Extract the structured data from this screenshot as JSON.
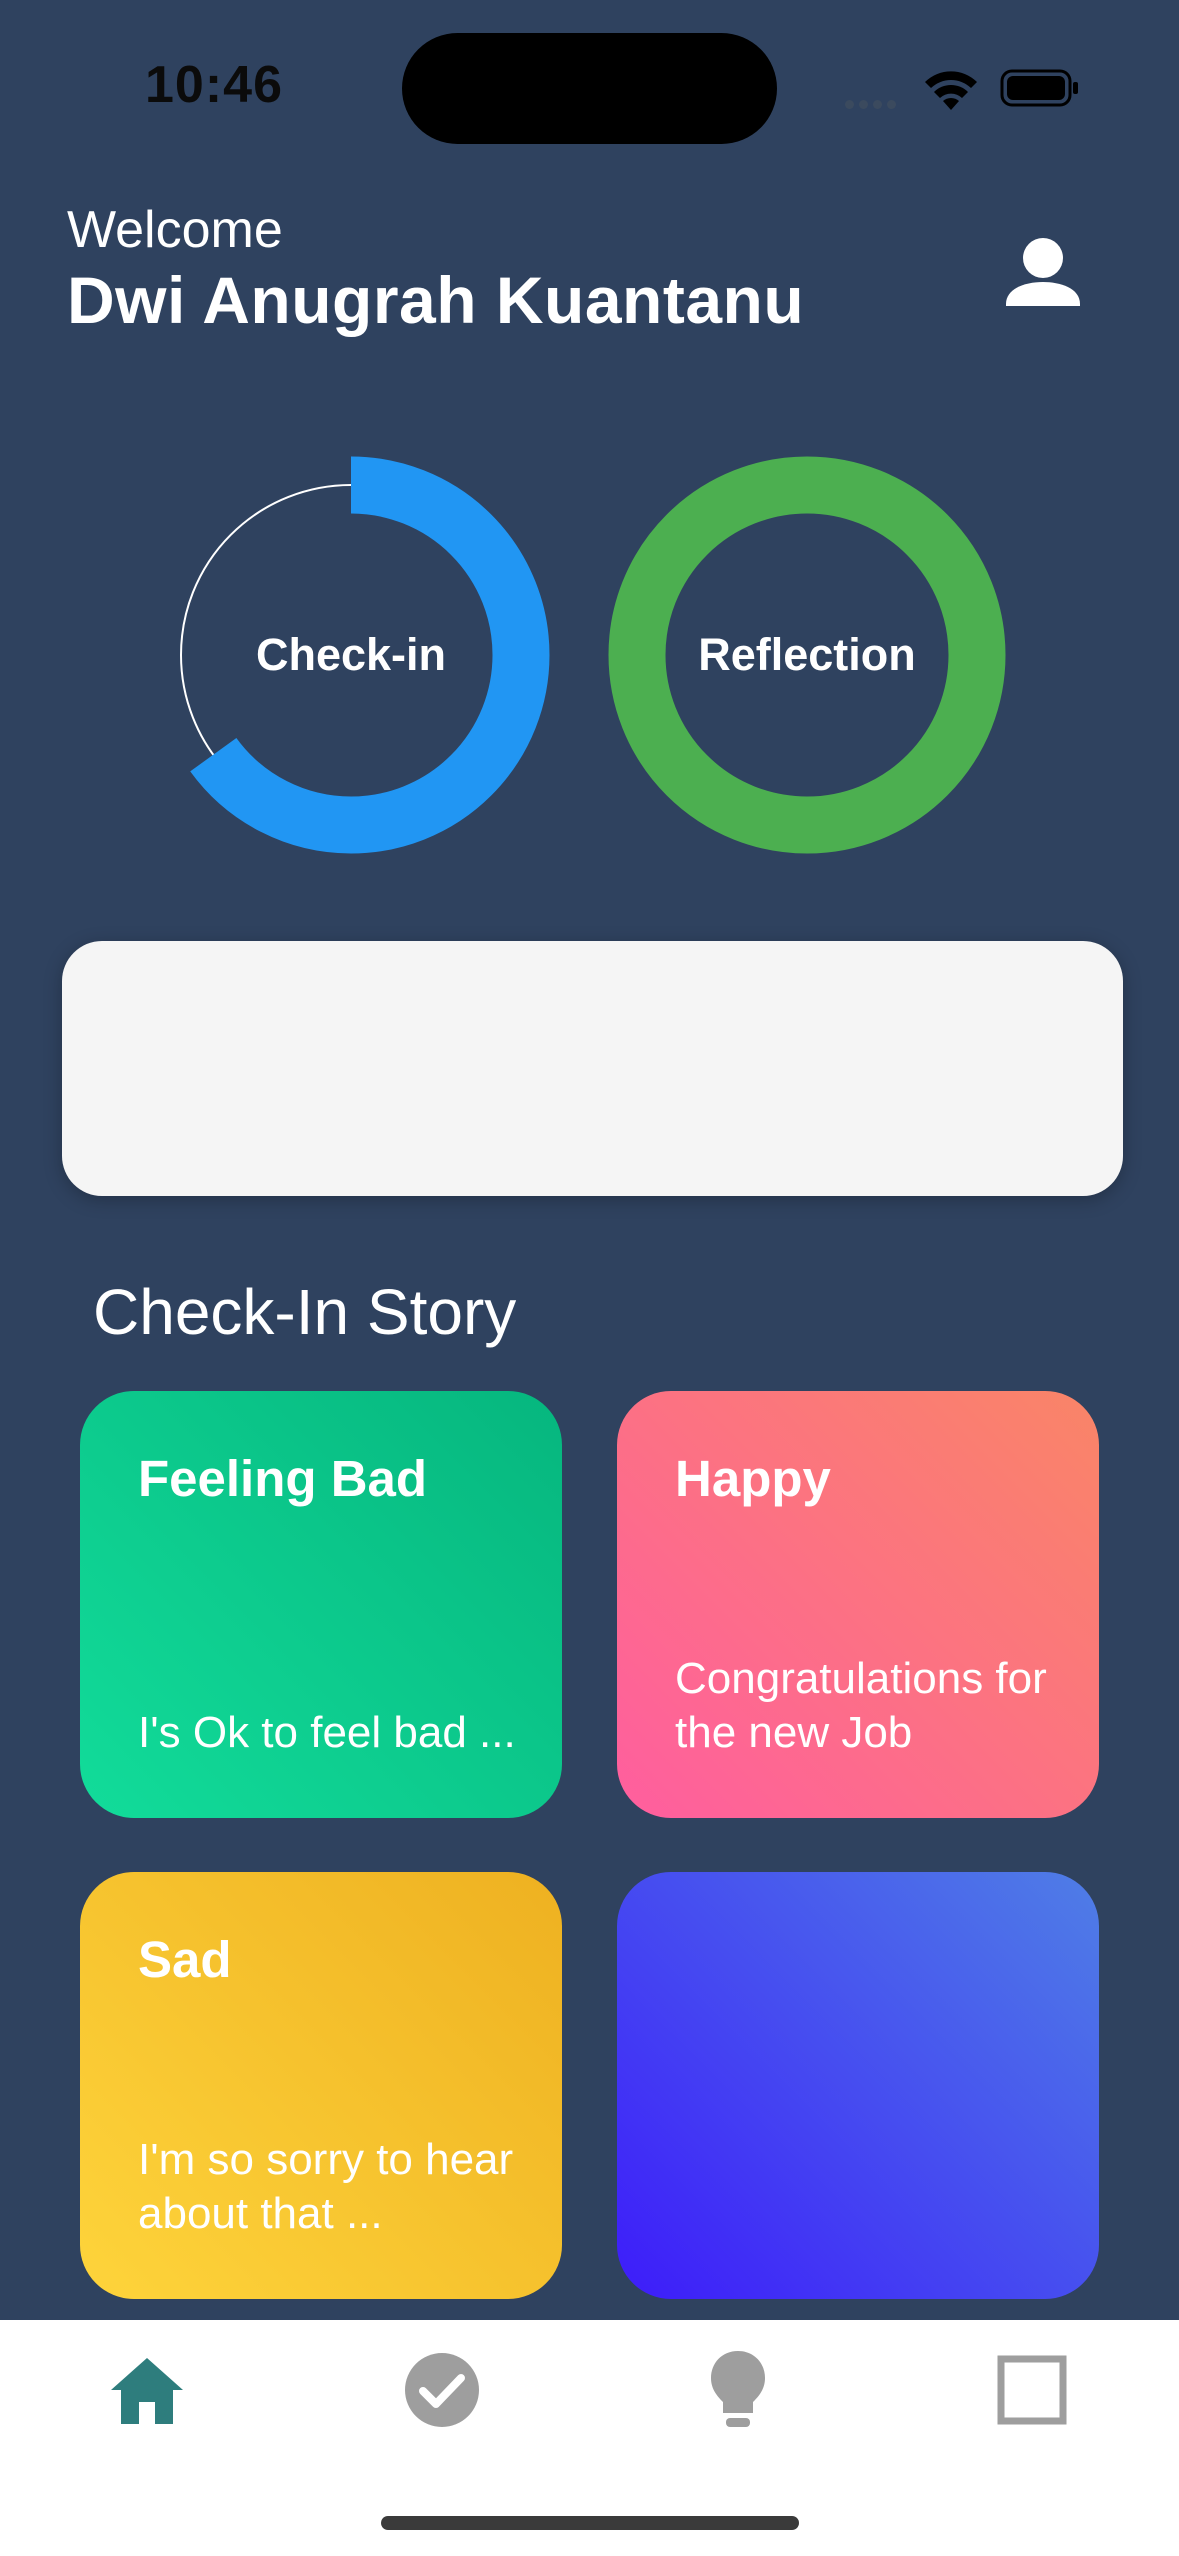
{
  "status_bar": {
    "time": "10:46"
  },
  "header": {
    "welcome_label": "Welcome",
    "user_name": "Dwi Anugrah Kuantanu"
  },
  "progress": {
    "checkin": {
      "label": "Check-in",
      "progress": 0.65,
      "color": "#2196f3"
    },
    "reflection": {
      "label": "Reflection",
      "progress": 1.0,
      "color": "#4caf50"
    }
  },
  "section": {
    "title": "Check-In Story"
  },
  "stories": [
    {
      "title": "Feeling Bad",
      "subtitle": "I's Ok to feel bad ..."
    },
    {
      "title": "Happy",
      "subtitle": "Congratulations for\nthe new Job"
    },
    {
      "title": "Sad",
      "subtitle": "I'm so sorry to hear\nabout that ..."
    },
    {
      "title": "",
      "subtitle": ""
    }
  ],
  "tab_bar": {
    "active_color": "#2e7d7d",
    "inactive_color": "#9e9e9e",
    "tabs": [
      {
        "icon": "home-icon",
        "active": true
      },
      {
        "icon": "check-circle-icon",
        "active": false
      },
      {
        "icon": "lightbulb-icon",
        "active": false
      },
      {
        "icon": "square-icon",
        "active": false
      }
    ]
  }
}
